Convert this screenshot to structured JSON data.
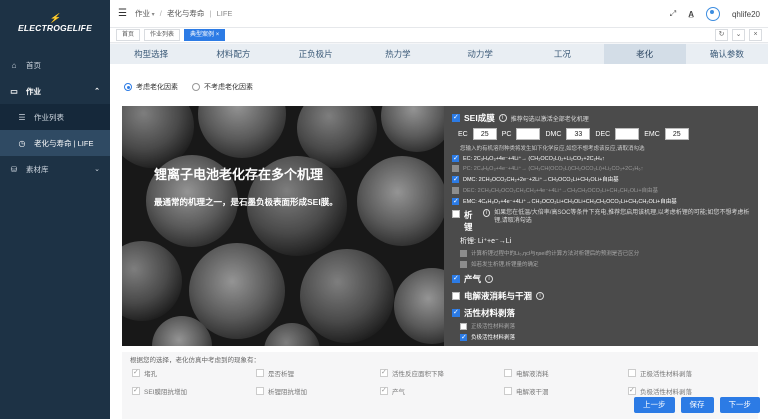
{
  "brand": {
    "logo_text": "ELECTROGELIFE"
  },
  "sidebar": {
    "items": [
      {
        "icon": "home-icon",
        "label": "首页"
      },
      {
        "icon": "folder-icon",
        "label": "作业"
      },
      {
        "icon": "list-icon",
        "label": "作业列表"
      },
      {
        "icon": "clock-icon",
        "label": "老化与寿命 | LIFE"
      },
      {
        "icon": "database-icon",
        "label": "素材库"
      }
    ]
  },
  "topbar": {
    "crumb_root": "作业",
    "crumb_mid": "老化与寿命",
    "crumb_leaf": "LIFE",
    "username": "qhlife20"
  },
  "tabs": [
    {
      "label": "首页"
    },
    {
      "label": "作业列表"
    },
    {
      "label": "典型案例 ×"
    }
  ],
  "steps": [
    {
      "label": "构型选择"
    },
    {
      "label": "材料配方"
    },
    {
      "label": "正负极片"
    },
    {
      "label": "热力学"
    },
    {
      "label": "动力学"
    },
    {
      "label": "工况"
    },
    {
      "label": "老化"
    },
    {
      "label": "确认参数"
    }
  ],
  "radios": {
    "consider": "考虑老化因素",
    "not_consider": "不考虑老化因素"
  },
  "picture": {
    "title": "锂离子电池老化存在多个机理",
    "subtitle": "最通常的机理之一，是石墨负极表面形成SEI膜。"
  },
  "panel": {
    "sei": {
      "title": "SEI成膜",
      "info": "推荐勾选以激活全部老化机理",
      "fields": [
        {
          "label": "EC",
          "value": "25"
        },
        {
          "label": "PC",
          "value": ""
        },
        {
          "label": "DMC",
          "value": "33"
        },
        {
          "label": "DEC",
          "value": ""
        },
        {
          "label": "EMC",
          "value": "25"
        }
      ],
      "prompt": "您输入的有机溶剂种类将发生如下化学反应,如您不想考虑该反应,请取消勾选",
      "reactions": [
        "EC: 2C₃H₄O₃+4e⁻+4Li⁺→ (CH₂OCO₂Li)₂+Li₂CO₃+2C₂H₄↑",
        "PC: 2C₄H₆O₃+4e⁻+4Li⁺→ (CH₃CH(OCO₂Li)CH₂OCO₂Li)+Li₂CO₃+2C₃H₆↑",
        "DMC: 2CH₃OCO₂CH₃+2e⁻+2Li⁺→CH₃OCO₂Li+CH₃OLi+自由基",
        "DEC: 2CH₃CH₂OCO₂CH₂CH₃+4e⁻+4Li⁺→CH₃CH₂OCO₂Li+CH₃CH₂OLi+自由基",
        "EMC: 4C₄H₈O₃+4e⁻+4Li⁺→CH₃OCO₂Li+CH₃OLi+CH₃CH₂OCO₂Li+CH₃CH₂OLi+自由基"
      ]
    },
    "plating": {
      "title": "析锂",
      "info": "如果您在低温/大倍率/高SOC等条件下充电,推荐您启用该机理,以考虑析锂的可能;如您不想考虑析锂,请取消勾选",
      "formula": "析锂:  Li⁺+e⁻→Li",
      "opt1": "计算析锂过程中的Li₀,ηcl与ηsei的计算方法对析锂后的预测是否已区分",
      "opt2": "如若发生析锂,析锂量的确定"
    },
    "gas": {
      "title": "产气"
    },
    "electrolyte": {
      "title": "电解液消耗与干涸"
    },
    "peeling": {
      "title": "活性材料剥落",
      "opt1": "正极活性材料剥落",
      "opt2": "负极活性材料剥落"
    }
  },
  "bottom": {
    "hint": "根据您的选择，老化仿真中考虑到的现象有：",
    "items": [
      "堵孔",
      "是否析锂",
      "活性反应面积下降",
      "电解液消耗",
      "正极活性材料剥落",
      "SEI膜阻抗增加",
      "析锂阻抗增加",
      "产气",
      "电解液干涸",
      "负极活性材料剥落"
    ]
  },
  "footer": {
    "prev": "上一步",
    "save": "保存",
    "next": "下一步"
  }
}
